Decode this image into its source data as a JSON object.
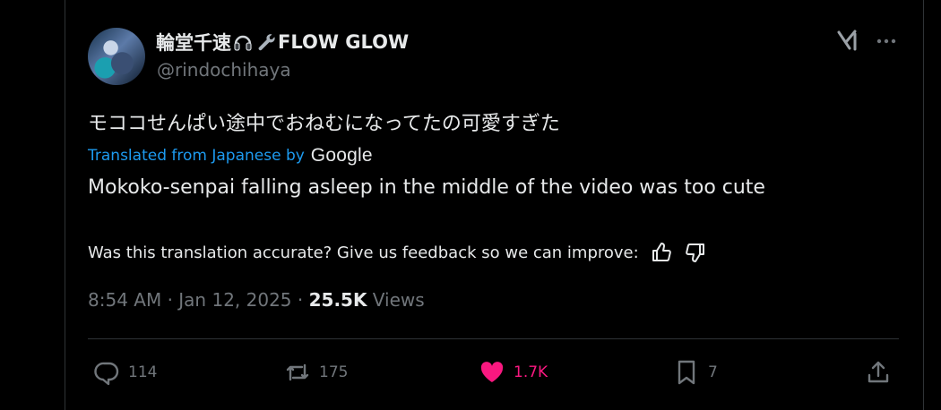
{
  "tweet": {
    "display_name_prefix": "輪堂千速",
    "display_name_suffix": "FLOW GLOW",
    "handle": "@rindochihaya",
    "text": "モココせんぱい途中でおねむになってたの可愛すぎた",
    "translated_label": "Translated from Japanese by",
    "translator": "Google",
    "translation": "Mokoko-senpai falling asleep in the middle of the video was too cute",
    "feedback_prompt": "Was this translation accurate? Give us feedback so we can improve:",
    "time": "8:54 AM · Jan 12, 2025 · ",
    "views_count": "25.5K",
    "views_label": " Views",
    "replies": "114",
    "reposts": "175",
    "likes": "1.7K",
    "bookmarks": "7"
  },
  "icons": [
    "headphones-icon",
    "wrench-icon",
    "grok-icon",
    "more-icon",
    "thumbs-up-icon",
    "thumbs-down-icon",
    "reply-icon",
    "repost-icon",
    "like-icon",
    "bookmark-icon",
    "share-icon"
  ],
  "colors": {
    "background": "#000000",
    "text": "#e7e9ea",
    "muted": "#71767b",
    "link": "#1d9bf0",
    "like": "#f91880",
    "border": "#2f3336"
  }
}
